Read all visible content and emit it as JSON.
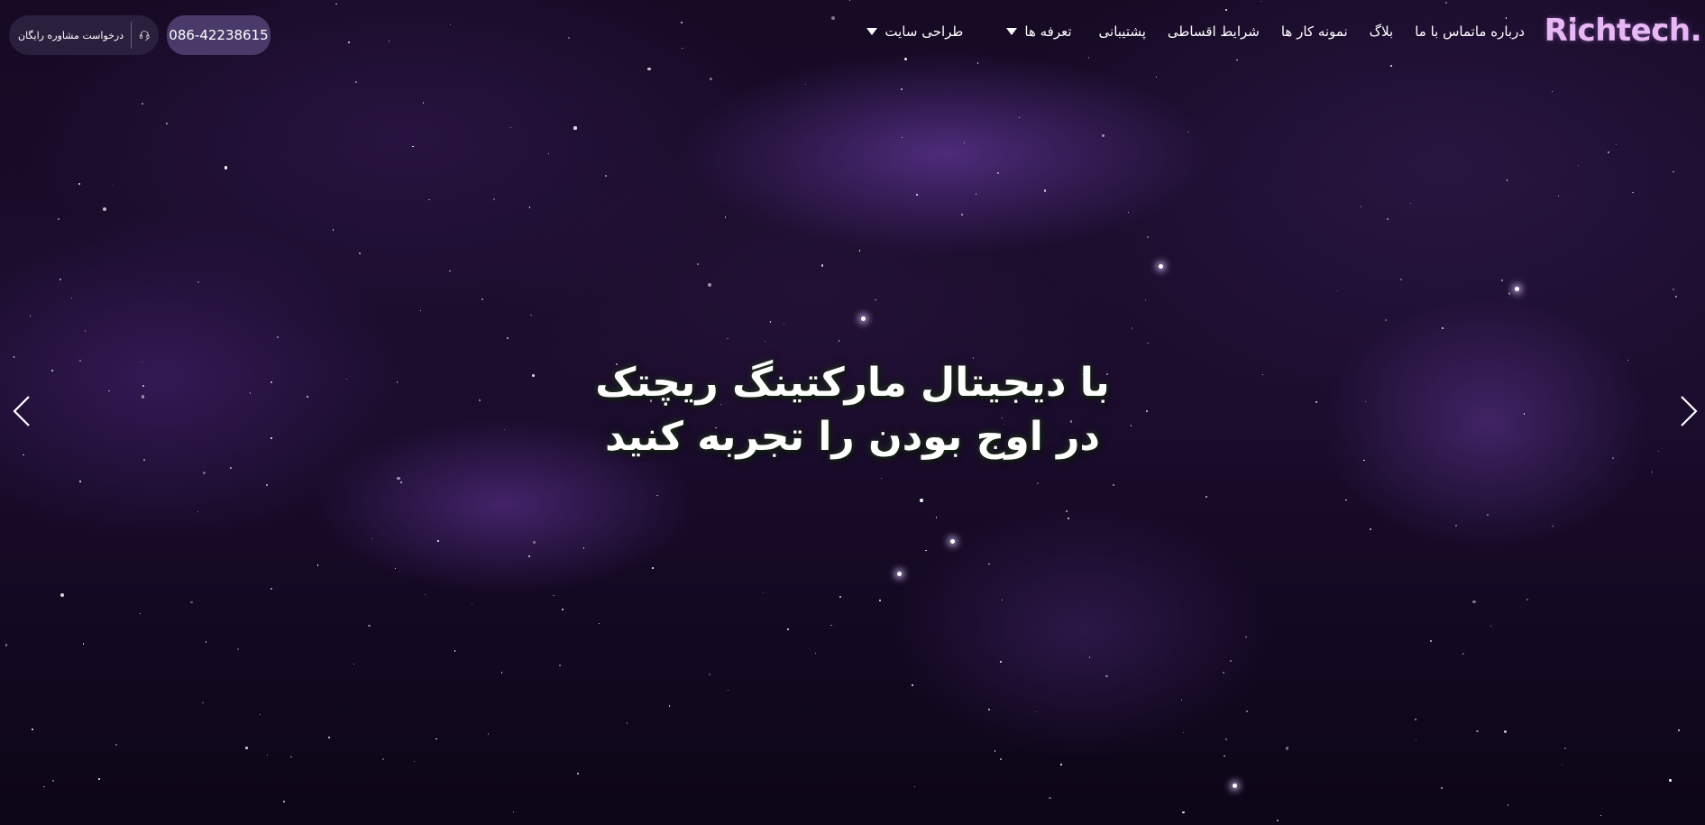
{
  "header": {
    "logo_text": "Richtech.",
    "nav": [
      {
        "label": "طراحی سایت",
        "has_dropdown": true
      },
      {
        "label": "تعرفه ها",
        "has_dropdown": true
      },
      {
        "label": "پشتیبانی",
        "has_dropdown": false
      },
      {
        "label": "شرایط اقساطی",
        "has_dropdown": false
      },
      {
        "label": "نمونه کار ها",
        "has_dropdown": false
      },
      {
        "label": "بلاگ",
        "has_dropdown": false
      },
      {
        "label": "تماس با ما",
        "has_dropdown": false
      },
      {
        "label": "درباره ما",
        "has_dropdown": false
      }
    ],
    "phone": "086-42238615",
    "consult_label": "درخواست مشاوره رایگان"
  },
  "hero": {
    "line1": "با دیجیتال مارکتینگ ریچتک",
    "line2": "در اوج بودن را تجربه کنید"
  },
  "slider": {
    "prev_icon": "chevron-left-icon",
    "next_icon": "chevron-right-icon"
  },
  "colors": {
    "logo": "#e7b8f5",
    "phone_button": "#493a6a",
    "consult_button": "#2a1f3d",
    "background": "#160a24"
  }
}
